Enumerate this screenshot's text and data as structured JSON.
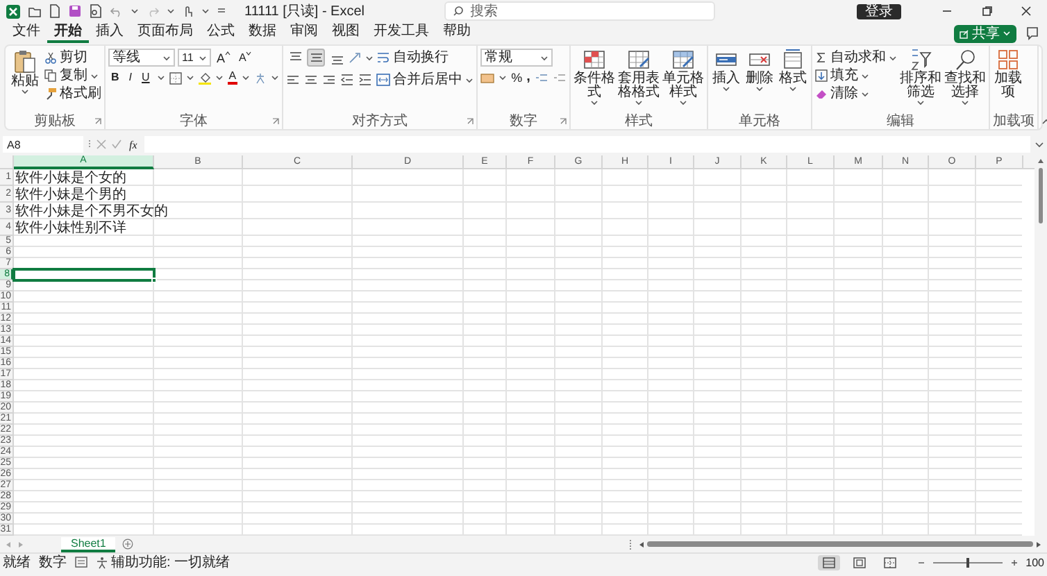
{
  "title_bar": {
    "title": "11111 [只读] - Excel",
    "search": {
      "placeholder": "搜索"
    },
    "sign_in": "登录"
  },
  "tabs": [
    {
      "label": "文件",
      "selected": false
    },
    {
      "label": "开始",
      "selected": true
    },
    {
      "label": "插入",
      "selected": false
    },
    {
      "label": "页面布局",
      "selected": false
    },
    {
      "label": "公式",
      "selected": false
    },
    {
      "label": "数据",
      "selected": false
    },
    {
      "label": "审阅",
      "selected": false
    },
    {
      "label": "视图",
      "selected": false
    },
    {
      "label": "开发工具",
      "selected": false
    },
    {
      "label": "帮助",
      "selected": false
    }
  ],
  "share": "共享",
  "ribbon": {
    "clipboard": {
      "label": "剪贴板",
      "paste": "粘贴",
      "items": [
        "剪切",
        "复制",
        "格式刷"
      ]
    },
    "font": {
      "label": "字体",
      "font_name": "等线",
      "font_size": "11",
      "grow": "A",
      "shrink": "A",
      "styles": [
        "B",
        "I",
        "U"
      ],
      "color_letter": "A"
    },
    "alignment": {
      "label": "对齐方式",
      "vertical": [
        {
          "kind": "top",
          "selected": false
        },
        {
          "kind": "middle",
          "selected": true
        },
        {
          "kind": "bottom",
          "selected": false
        }
      ],
      "wrap": "自动换行",
      "merge": "合并后居中"
    },
    "number": {
      "label": "数字",
      "format": "常规",
      "percent": "%",
      "comma": ","
    },
    "styles": {
      "label": "样式",
      "buttons": [
        "条件格式",
        "套用表格格式",
        "单元格样式"
      ]
    },
    "cells": {
      "label": "单元格",
      "buttons": [
        "插入",
        "删除",
        "格式"
      ]
    },
    "editing": {
      "label": "编辑",
      "items": [
        "自动求和",
        "填充",
        "清除"
      ],
      "buttons": [
        "排序和筛选",
        "查找和选择"
      ]
    },
    "addins": {
      "label": "加载项",
      "buttons": [
        "加载项"
      ]
    }
  },
  "formula_bar": {
    "name_box": "A8",
    "fx": "fx"
  },
  "sheet": {
    "columns": [
      {
        "label": "A",
        "selected": true
      },
      {
        "label": "B",
        "selected": false
      },
      {
        "label": "C",
        "selected": false
      },
      {
        "label": "D",
        "selected": false
      },
      {
        "label": "E",
        "selected": false
      },
      {
        "label": "F",
        "selected": false
      },
      {
        "label": "G",
        "selected": false
      },
      {
        "label": "H",
        "selected": false
      },
      {
        "label": "I",
        "selected": false
      },
      {
        "label": "J",
        "selected": false
      },
      {
        "label": "K",
        "selected": false
      },
      {
        "label": "L",
        "selected": false
      },
      {
        "label": "M",
        "selected": false
      },
      {
        "label": "N",
        "selected": false
      },
      {
        "label": "O",
        "selected": false
      },
      {
        "label": "P",
        "selected": false
      }
    ],
    "rows": [
      {
        "label": "1",
        "selected": false,
        "cells": [
          "软件小妹是个女的"
        ]
      },
      {
        "label": "2",
        "selected": false,
        "cells": [
          "软件小妹是个男的"
        ]
      },
      {
        "label": "3",
        "selected": false,
        "cells": [
          "软件小妹是个不男不女的"
        ]
      },
      {
        "label": "4",
        "selected": false,
        "cells": [
          "软件小妹性别不详"
        ]
      },
      {
        "label": "5",
        "selected": false
      },
      {
        "label": "6",
        "selected": false
      },
      {
        "label": "7",
        "selected": false
      },
      {
        "label": "8",
        "selected": true
      },
      {
        "label": "9",
        "selected": false
      },
      {
        "label": "10",
        "selected": false
      },
      {
        "label": "11",
        "selected": false
      },
      {
        "label": "12",
        "selected": false
      },
      {
        "label": "13",
        "selected": false
      },
      {
        "label": "14",
        "selected": false
      },
      {
        "label": "15",
        "selected": false
      },
      {
        "label": "16",
        "selected": false
      },
      {
        "label": "17",
        "selected": false
      },
      {
        "label": "18",
        "selected": false
      },
      {
        "label": "19",
        "selected": false
      },
      {
        "label": "20",
        "selected": false
      },
      {
        "label": "21",
        "selected": false
      },
      {
        "label": "22",
        "selected": false
      },
      {
        "label": "23",
        "selected": false
      },
      {
        "label": "24",
        "selected": false
      },
      {
        "label": "25",
        "selected": false
      },
      {
        "label": "26",
        "selected": false
      },
      {
        "label": "27",
        "selected": false
      },
      {
        "label": "28",
        "selected": false
      },
      {
        "label": "29",
        "selected": false
      },
      {
        "label": "30",
        "selected": false
      },
      {
        "label": "31",
        "selected": false
      }
    ]
  },
  "sheet_tabs": [
    {
      "label": "Sheet1",
      "selected": true
    }
  ],
  "status_bar": {
    "ready": "就绪",
    "mode": "数字",
    "accessibility": "辅助功能: 一切就绪",
    "views": [
      {
        "kind": "normal",
        "selected": true
      },
      {
        "kind": "page_layout",
        "selected": false
      },
      {
        "kind": "page_break",
        "selected": false
      }
    ],
    "zoom": {
      "level": 0.5,
      "reading": "100"
    }
  }
}
